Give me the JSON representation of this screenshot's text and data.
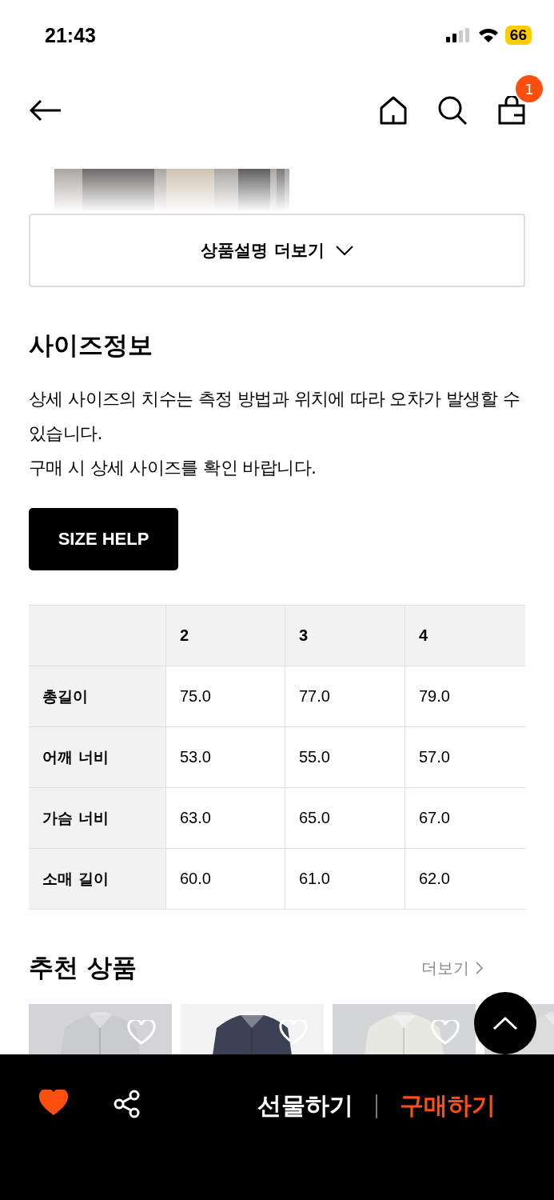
{
  "status_bar": {
    "time": "21:43",
    "battery": "66"
  },
  "nav": {
    "cart_count": "1"
  },
  "description": {
    "more_button": "상품설명 더보기"
  },
  "size_info": {
    "title": "사이즈정보",
    "notice": [
      "상세 사이즈의 치수는 측정 방법과 위치에 따라 오차가 발생할 수 있습니다.",
      "구매 시 상세 사이즈를 확인 바랍니다."
    ],
    "help_button": "SIZE HELP",
    "table": {
      "columns": [
        "2",
        "3",
        "4"
      ],
      "rows": [
        {
          "label": "총길이",
          "values": [
            "75.0",
            "77.0",
            "79.0"
          ]
        },
        {
          "label": "어깨 너비",
          "values": [
            "53.0",
            "55.0",
            "57.0"
          ]
        },
        {
          "label": "가슴 너비",
          "values": [
            "63.0",
            "65.0",
            "67.0"
          ]
        },
        {
          "label": "소매 길이",
          "values": [
            "60.0",
            "61.0",
            "62.0"
          ]
        }
      ]
    }
  },
  "recommended": {
    "title": "추천 상품",
    "more_link": "더보기"
  },
  "bottom_bar": {
    "liked": true,
    "gift_button": "선물하기",
    "buy_button": "구매하기"
  }
}
